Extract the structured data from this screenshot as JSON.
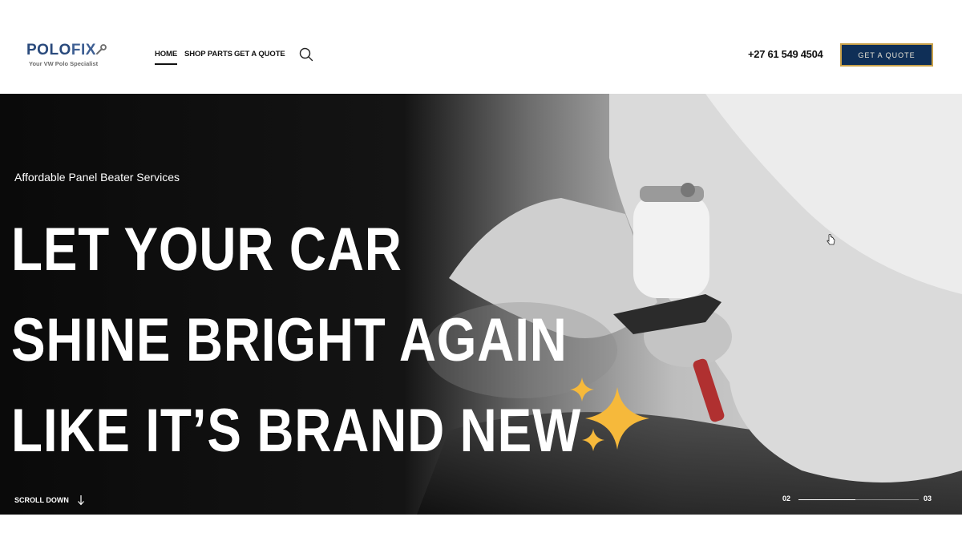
{
  "brand": {
    "logo_polo": "POLO",
    "logo_fix": "FIX",
    "tagline": "Your VW Polo Specialist"
  },
  "nav": {
    "items": [
      {
        "label": "HOME",
        "active": true
      },
      {
        "label": "SHOP PARTS",
        "active": false
      },
      {
        "label": "GET A QUOTE",
        "active": false
      }
    ],
    "search_icon": "search-icon"
  },
  "header": {
    "phone": "+27 61 549 4504",
    "cta_label": "GET A QUOTE"
  },
  "hero": {
    "eyebrow": "Affordable Panel Beater Services",
    "headline": [
      "LET YOUR CAR",
      "SHINE BRIGHT AGAIN",
      "LIKE IT’S BRAND NEW"
    ],
    "sparkle_icon": "sparkles-icon",
    "scroll_label": "SCROLL DOWN",
    "slider": {
      "current": "02",
      "total": "03",
      "progress": 0.47
    }
  },
  "colors": {
    "brand_navy": "#0f2f57",
    "brand_gold": "#c9a14a",
    "sparkle": "#f6b93b"
  }
}
